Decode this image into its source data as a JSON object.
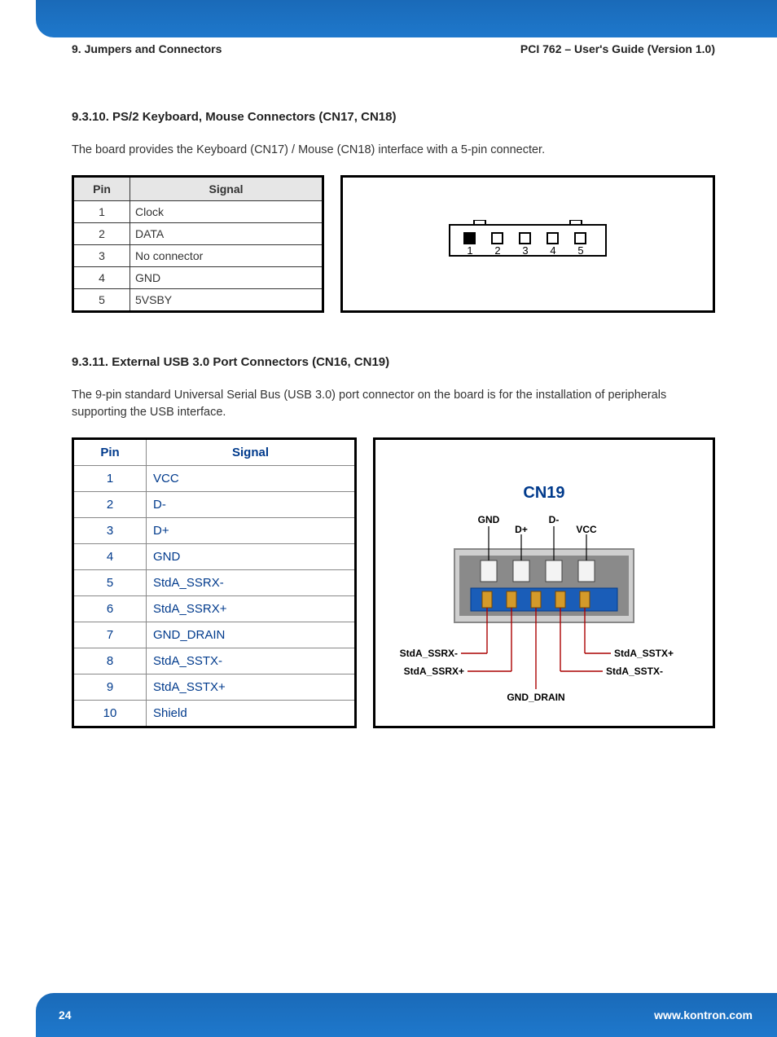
{
  "header": {
    "left": "9. Jumpers and Connectors",
    "right": "PCI 762 – User's Guide (Version 1.0)"
  },
  "section1": {
    "title": "9.3.10. PS/2 Keyboard, Mouse Connectors (CN17, CN18)",
    "intro": "The board provides the Keyboard (CN17) / Mouse (CN18) interface with a 5-pin connecter.",
    "th_pin": "Pin",
    "th_sig": "Signal",
    "rows": [
      {
        "pin": "1",
        "sig": "Clock"
      },
      {
        "pin": "2",
        "sig": "DATA"
      },
      {
        "pin": "3",
        "sig": "No connector"
      },
      {
        "pin": "4",
        "sig": "GND"
      },
      {
        "pin": "5",
        "sig": "5VSBY"
      }
    ],
    "dia_nums": [
      "1",
      "2",
      "3",
      "4",
      "5"
    ]
  },
  "section2": {
    "title": "9.3.11. External USB 3.0 Port Connectors (CN16, CN19)",
    "intro": "The 9-pin standard Universal Serial Bus (USB 3.0) port connector on the board is for the installation of peripherals supporting the USB interface.",
    "th_pin": "Pin",
    "th_sig": "Signal",
    "rows": [
      {
        "pin": "1",
        "sig": "VCC"
      },
      {
        "pin": "2",
        "sig": "D-"
      },
      {
        "pin": "3",
        "sig": "D+"
      },
      {
        "pin": "4",
        "sig": "GND"
      },
      {
        "pin": "5",
        "sig": "StdA_SSRX-"
      },
      {
        "pin": "6",
        "sig": "StdA_SSRX+"
      },
      {
        "pin": "7",
        "sig": "GND_DRAIN"
      },
      {
        "pin": "8",
        "sig": "StdA_SSTX-"
      },
      {
        "pin": "9",
        "sig": "StdA_SSTX+"
      },
      {
        "pin": "10",
        "sig": "Shield"
      }
    ],
    "dia": {
      "title": "CN19",
      "top_labels": {
        "gnd": "GND",
        "dplus": "D+",
        "dminus": "D-",
        "vcc": "VCC"
      },
      "bot_labels": {
        "ssrxn": "StdA_SSRX-",
        "ssrxp": "StdA_SSRX+",
        "sstxp": "StdA_SSTX+",
        "sstxn": "StdA_SSTX-",
        "drain": "GND_DRAIN"
      }
    }
  },
  "footer": {
    "page": "24",
    "url": "www.kontron.com"
  }
}
